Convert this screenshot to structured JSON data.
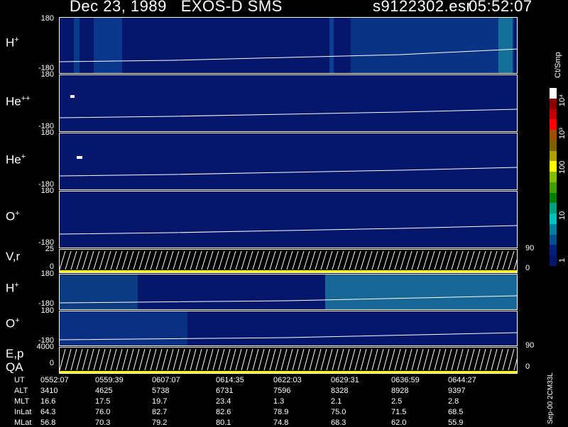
{
  "header": {
    "title": "Dec 23, 1989   EXOS-D SMS",
    "file": "s9122302.esr",
    "time": "05:52:07"
  },
  "panels": [
    {
      "label": "H",
      "charge": "+",
      "top_tick": "180",
      "bottom_tick": "-180"
    },
    {
      "label": "He",
      "charge": "++",
      "top_tick": "180",
      "bottom_tick": "-180"
    },
    {
      "label": "He",
      "charge": "+",
      "top_tick": "180",
      "bottom_tick": "-180"
    },
    {
      "label": "O",
      "charge": "+",
      "top_tick": "180",
      "bottom_tick": "-180"
    }
  ],
  "vr_panel": {
    "label": "V,r",
    "top_tick": "25",
    "bottom_tick": "0",
    "right_top": "90",
    "right_bottom": "0"
  },
  "lower_panels": [
    {
      "label": "H",
      "charge": "+",
      "top_tick": "180",
      "bottom_tick": "-180"
    },
    {
      "label": "O",
      "charge": "+",
      "top_tick": "180",
      "bottom_tick": "-180"
    }
  ],
  "ep_panel": {
    "label1": "E,p",
    "label2": "QA",
    "top_tick": "4000",
    "bottom_tick": "0",
    "right_top": "90",
    "right_bottom": "0"
  },
  "colorbar": {
    "unit": "Ct/Smp",
    "ticks": [
      "10⁴",
      "10³",
      "100",
      "10",
      "1"
    ],
    "colors": [
      "#ffffff",
      "#8b0000",
      "#c00000",
      "#ff0000",
      "#a05000",
      "#806000",
      "#b0a000",
      "#ffff00",
      "#80c000",
      "#40a000",
      "#008000",
      "#00a080",
      "#00c0c0",
      "#0080a0",
      "#005090",
      "#002080",
      "#06166b"
    ]
  },
  "info_rows": {
    "labels": [
      "UT",
      "ALT",
      "MLT",
      "InLat",
      "MLat"
    ],
    "columns": [
      [
        "0552:07",
        "3410",
        "16.6",
        "64.3",
        "56.8"
      ],
      [
        "0559:39",
        "4625",
        "17.5",
        "76.0",
        "70.3"
      ],
      [
        "0607:07",
        "5738",
        "19.7",
        "82.7",
        "79.2"
      ],
      [
        "0614:35",
        "6731",
        "23.4",
        "82.6",
        "80.1"
      ],
      [
        "0622:03",
        "7596",
        "1.3",
        "78.9",
        "74.8"
      ],
      [
        "0629:31",
        "8328",
        "2.1",
        "75.0",
        "68.3"
      ],
      [
        "0636:59",
        "8928",
        "2.5",
        "71.5",
        "62.0"
      ],
      [
        "0644:27",
        "9397",
        "2.8",
        "68.5",
        "55.9"
      ]
    ]
  },
  "footer_vertical": "Sep-00 2CM33L"
}
